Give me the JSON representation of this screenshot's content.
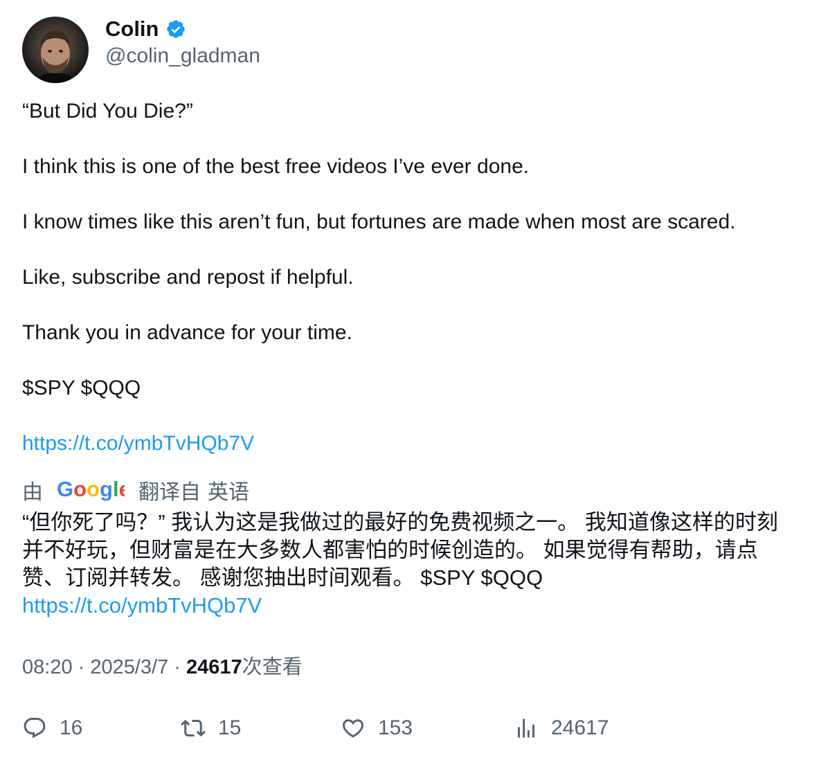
{
  "author": {
    "display_name": "Colin",
    "handle": "@colin_gladman",
    "verified": true,
    "verified_color": "#1d9bf0"
  },
  "tweet": {
    "paragraphs": [
      "“But Did You Die?”",
      "I think this is one of the best free videos I’ve ever done.",
      "I know times like this aren’t fun, but fortunes are made when most are scared.",
      "Like, subscribe and repost if helpful.",
      "Thank you in advance for your time.",
      "$SPY $QQQ"
    ],
    "link": "https://t.co/ymbTvHQb7V"
  },
  "translation": {
    "prefix": "由",
    "provider": "Google",
    "suffix": "翻译自",
    "language": "英语",
    "lines": [
      "“但你死了吗？” 我认为这是我做过的最好的免费视频之一。 我知道像这样的时刻",
      "并不好玩，但财富是在大多数人都害怕的时候创造的。 如果觉得有帮助，请点",
      "赞、订阅并转发。 感谢您抽出时间观看。 $SPY $QQQ"
    ],
    "link": "https://t.co/ymbTvHQb7V"
  },
  "meta": {
    "time": "08:20",
    "separator": " · ",
    "date": "2025/3/7",
    "views": "24617",
    "views_label": "次查看"
  },
  "actions": {
    "reply_count": "16",
    "retweet_count": "15",
    "like_count": "153",
    "views_count": "24617"
  },
  "icons": {
    "reply": "reply-icon",
    "retweet": "retweet-icon",
    "like": "heart-icon",
    "views": "views-chart-icon",
    "verified": "verified-badge-icon"
  },
  "colors": {
    "text": "#0f1419",
    "secondary": "#536471",
    "link": "#1d9bf0"
  }
}
